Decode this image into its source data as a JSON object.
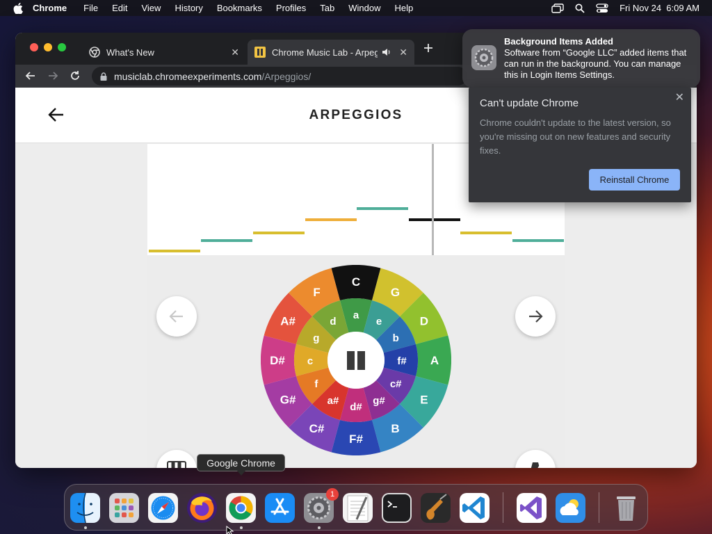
{
  "menubar": {
    "app_name": "Chrome",
    "items": [
      "File",
      "Edit",
      "View",
      "History",
      "Bookmarks",
      "Profiles",
      "Tab",
      "Window",
      "Help"
    ],
    "datetime": "Fri Nov 24  6:09 AM"
  },
  "tabs": [
    {
      "title": "What's New"
    },
    {
      "title": "Chrome Music Lab - Arpeg"
    }
  ],
  "address": {
    "host": "musiclab.chromeexperiments.com",
    "path": "/Arpeggios/"
  },
  "page": {
    "title": "ARPEGGIOS"
  },
  "wheel": {
    "outer_keys": [
      "C",
      "G",
      "D",
      "A",
      "E",
      "B",
      "F#",
      "C#",
      "G#",
      "D#",
      "A#",
      "F"
    ],
    "inner_keys": [
      "a",
      "e",
      "b",
      "f#",
      "c#",
      "g#",
      "d#",
      "a#",
      "f",
      "c",
      "g",
      "d"
    ],
    "selected": "C"
  },
  "notification": {
    "title": "Background Items Added",
    "body": "Software from “Google LLC” added items that can run in the background. You can manage this in Login Items Settings."
  },
  "update_popup": {
    "title": "Can't update Chrome",
    "body": "Chrome couldn't update to the latest version, so you're missing out on new features and security fixes.",
    "button": "Reinstall Chrome"
  },
  "dock": {
    "tooltip": "Google Chrome",
    "badge": "1",
    "apps": [
      "Finder",
      "Launchpad",
      "Safari",
      "Firefox",
      "Google Chrome",
      "App Store",
      "System Settings",
      "TextEdit",
      "Terminal",
      "GarageBand",
      "Visual Studio Code",
      "Visual Studio",
      "Weather",
      "Trash"
    ]
  },
  "colors": {
    "yellow": "#d8be2e",
    "orange": "#eeae3a",
    "teal": "#4fae99",
    "accent_button": "#8ab4f8"
  }
}
